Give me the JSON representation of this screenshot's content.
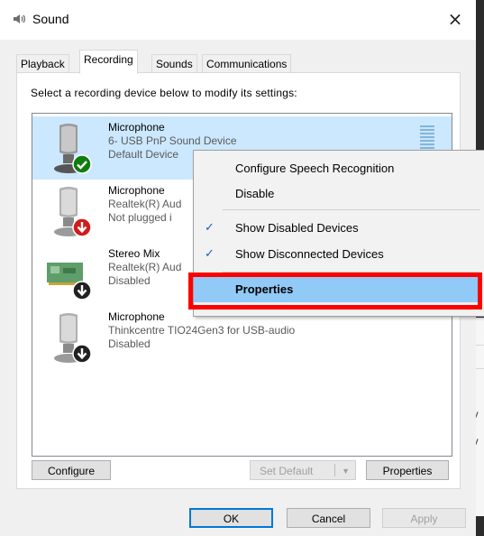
{
  "window": {
    "title": "Sound",
    "close": "×"
  },
  "tabs": [
    {
      "label": "Playback"
    },
    {
      "label": "Recording"
    },
    {
      "label": "Sounds"
    },
    {
      "label": "Communications"
    }
  ],
  "instruction": "Select a recording device below to modify its settings:",
  "devices": [
    {
      "name": "Microphone",
      "sub": "6- USB PnP Sound Device",
      "status": "Default Device",
      "badge": "check-icon"
    },
    {
      "name": "Microphone",
      "sub": "Realtek(R) Aud",
      "status": "Not plugged i",
      "badge": "down-arrow-icon"
    },
    {
      "name": "Stereo Mix",
      "sub": "Realtek(R) Aud",
      "status": "Disabled",
      "badge": "down-arrow-icon"
    },
    {
      "name": "Microphone",
      "sub": "Thinkcentre TIO24Gen3 for USB-audio",
      "status": "Disabled",
      "badge": "down-arrow-icon"
    }
  ],
  "buttons": {
    "configure": "Configure",
    "set_default": "Set Default",
    "properties": "Properties",
    "ok": "OK",
    "cancel": "Cancel",
    "apply": "Apply"
  },
  "context_menu": {
    "items": [
      {
        "label": "Configure Speech Recognition",
        "checked": false
      },
      {
        "label": "Disable",
        "checked": false
      },
      {
        "label": "Show Disabled Devices",
        "checked": true
      },
      {
        "label": "Show Disconnected Devices",
        "checked": true
      },
      {
        "label": "Properties",
        "checked": false,
        "highlighted": true
      }
    ],
    "check_glyph": "✓"
  },
  "background_window": {
    "fragments": [
      "al",
      "a",
      "a",
      "pv",
      "pv",
      "p"
    ]
  },
  "colors": {
    "selection": "#cce8ff",
    "menu_highlight": "#91c9f7",
    "annotation_box": "#ff0000",
    "accent": "#0078d7"
  }
}
